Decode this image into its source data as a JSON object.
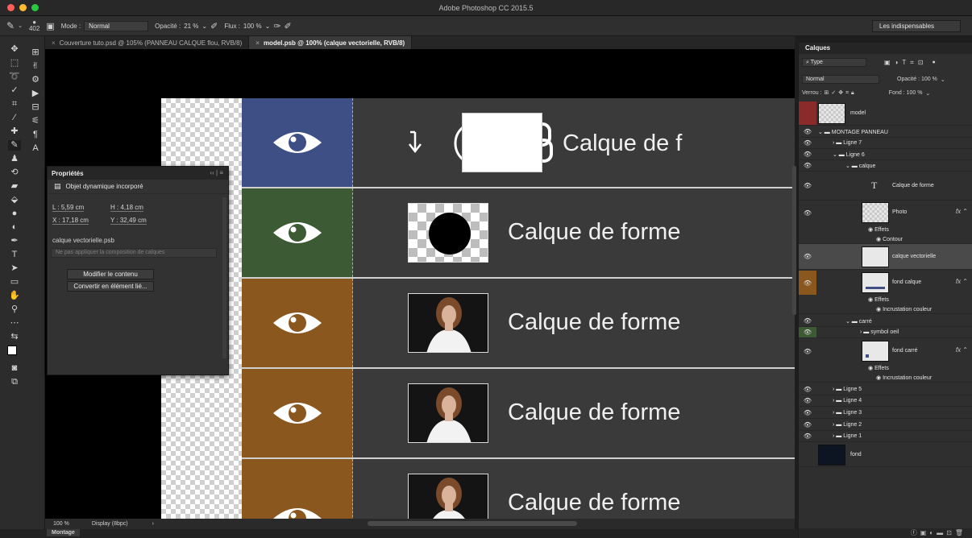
{
  "app": {
    "window_title": "Adobe Photoshop CC 2015.5"
  },
  "colors": {
    "red_light": "#ff5f57",
    "yellow_light": "#febc2e",
    "green_light": "#28c840",
    "row_blue": "#3d4f85",
    "row_green": "#3c5a33",
    "row_orange": "#8a571e",
    "layer_red": "#8a2a2a",
    "layer_orange": "#8a571e",
    "layer_green": "#3c5a33"
  },
  "options_bar": {
    "brush_size": "402",
    "mode_label": "Mode :",
    "mode_value": "Normal",
    "opacity_label": "Opacité :",
    "opacity_value": "21 %",
    "flow_label": "Flux :",
    "flow_value": "100 %",
    "workspace": "Les indispensables"
  },
  "tabs": [
    {
      "label": "Couverture tuto.psd @ 105% (PANNEAU CALQUE flou, RVB/8)"
    },
    {
      "label": "model.psb @ 100% (calque vectorielle, RVB/8)"
    }
  ],
  "canvas": {
    "row_label_1": "Calque de f",
    "row_label": "Calque de forme"
  },
  "properties": {
    "title": "Propriétés",
    "type": "Objet dynamique incorporé",
    "L": "L : 5,59 cm",
    "H": "H : 4,18 cm",
    "X": "X : 17,18 cm",
    "Y": "Y : 32,49 cm",
    "filename": "calque vectorielle.psb",
    "comp_placeholder": "Ne pas appliquer la composition de calques",
    "btn_edit": "Modifier le contenu",
    "btn_convert": "Convertir en élément lié..."
  },
  "status": {
    "zoom": "100 %",
    "display": "Display (8bpc)",
    "bottom_tab": "Montage"
  },
  "layers": {
    "panel_title": "Calques",
    "kind_filter": "Type",
    "blend_mode": "Normal",
    "opacity_label": "Opacité : 100 %",
    "lock_label": "Verrou :",
    "fill_label": "Fond : 100 %",
    "items": {
      "model": "model",
      "montage": "MONTAGE PANNEAU",
      "ligne7": "Ligne 7",
      "ligne6": "Ligne 6",
      "calque": "calque",
      "calque_de_forme": "Calque de forme",
      "photo": "Photo",
      "effets": "Effets",
      "contour": "Contour",
      "calque_vectorielle": "calque vectorielle",
      "fond_calque": "fond calque",
      "incrustation": "Incrustation couleur",
      "carre": "carré",
      "symbol_oeil": "symbol oeil",
      "fond_carre": "fond carré",
      "ligne5": "Ligne 5",
      "ligne4": "Ligne 4",
      "ligne3": "Ligne 3",
      "ligne2": "Ligne 2",
      "ligne1": "Ligne 1",
      "fond": "fond"
    }
  }
}
